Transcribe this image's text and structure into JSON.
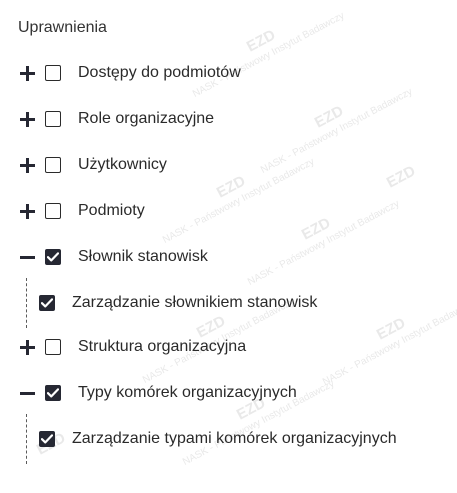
{
  "section": {
    "title": "Uprawnienia"
  },
  "permissions": [
    {
      "label": "Dostępy do podmiotów",
      "expanded": false,
      "checked": false
    },
    {
      "label": "Role organizacyjne",
      "expanded": false,
      "checked": false
    },
    {
      "label": "Użytkownicy",
      "expanded": false,
      "checked": false
    },
    {
      "label": "Podmioty",
      "expanded": false,
      "checked": false
    },
    {
      "label": "Słownik stanowisk",
      "expanded": true,
      "checked": true,
      "children": [
        {
          "label": "Zarządzanie słownikiem stanowisk",
          "checked": true
        }
      ]
    },
    {
      "label": "Struktura organizacyjna",
      "expanded": false,
      "checked": false
    },
    {
      "label": "Typy komórek organizacyjnych",
      "expanded": true,
      "checked": true,
      "children": [
        {
          "label": "Zarządzanie typami komórek organizacyjnych",
          "checked": true
        }
      ]
    }
  ],
  "watermark": {
    "logo_text": "EZD",
    "org_text": "NASK - Państwowy Instytut Badawczy"
  },
  "colors": {
    "checkbox_checked": "#262833",
    "text": "#2a2a2a"
  }
}
